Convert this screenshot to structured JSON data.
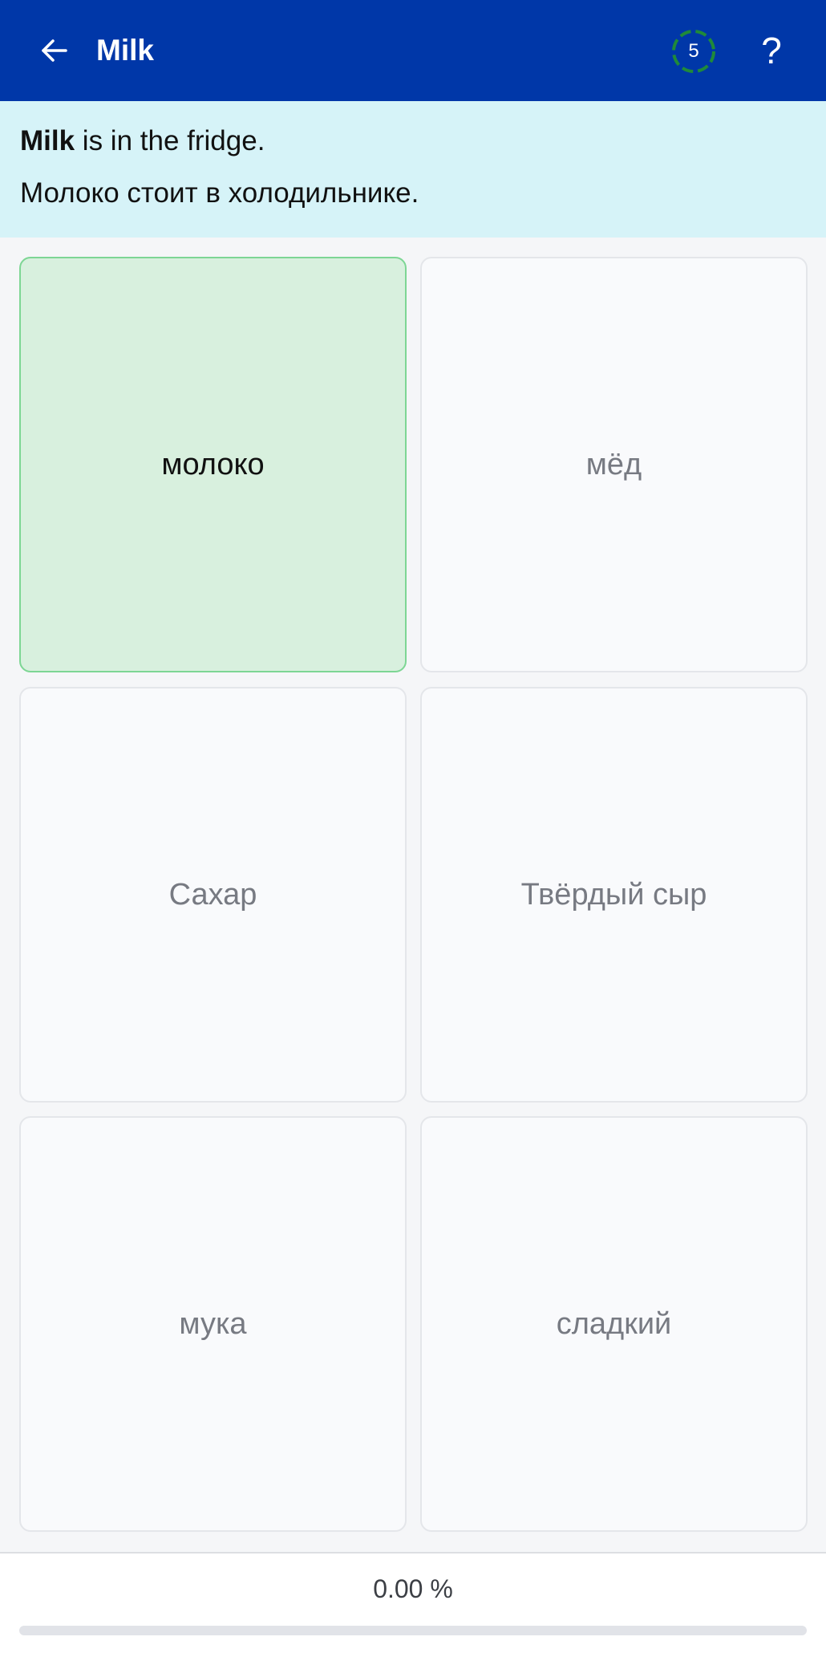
{
  "header": {
    "title": "Milk",
    "timer_count": "5",
    "help_label": "?",
    "back_icon": "arrow-left-icon"
  },
  "prompt": {
    "english_bold": "Milk",
    "english_rest": " is in the fridge.",
    "russian": "Молоко стоит в холодильнике."
  },
  "options": [
    {
      "label": "молоко",
      "selected": true
    },
    {
      "label": "мёд",
      "selected": false
    },
    {
      "label": "Сахар",
      "selected": false
    },
    {
      "label": "Твёрдый сыр",
      "selected": false
    },
    {
      "label": "мука",
      "selected": false
    },
    {
      "label": "сладкий",
      "selected": false
    }
  ],
  "footer": {
    "progress_label": "0.00 %",
    "progress_fraction": 0
  },
  "colors": {
    "header_bg": "#0037a8",
    "prompt_bg": "#d6f3f8",
    "selected_bg": "#d8f0de",
    "selected_border": "#7dd694",
    "timer_ring": "#1f8a3a"
  }
}
